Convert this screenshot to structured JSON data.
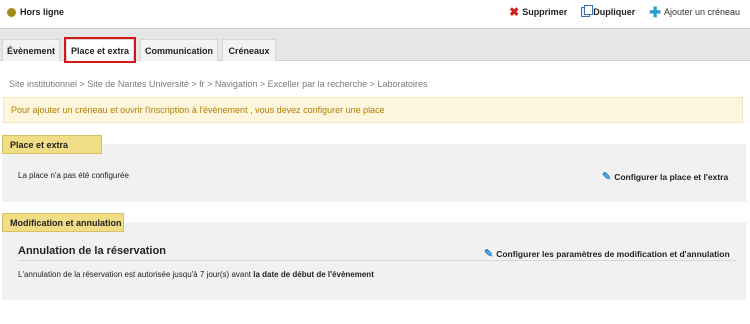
{
  "status": {
    "label": "Hors ligne"
  },
  "actions": {
    "delete": "Supprimer",
    "duplicate": "Dupliquer",
    "add_slot": "Ajouter un créneau"
  },
  "tabs": [
    {
      "label": "Évènement"
    },
    {
      "label": "Place et extra"
    },
    {
      "label": "Communication"
    },
    {
      "label": "Créneaux"
    }
  ],
  "breadcrumb": "Site institutionnel > Site de Nantes Université > fr > Navigation > Exceller par la recherche > Laboratoires",
  "warning": "Pour ajouter un créneau et ouvrir l'inscription à l'évènement , vous devez configurer une place",
  "place_section": {
    "title": "Place et extra",
    "text": "La place n'a pas été configurée",
    "link": "Configurer la place et l'extra"
  },
  "modif_section": {
    "title": "Modification et annulation",
    "subtitle": "Annulation de la réservation",
    "link": "Configurer les paramètres de modification et d'annulation",
    "text_prefix": "L'annulation de la réservation est autorisée jusqu'à",
    "days": "7",
    "text_middle": "jour(s) avant",
    "text_bold": "la date de début de l'évènement"
  },
  "colors": {
    "active_tab_outline": "#d11717",
    "section_header": "#f1dd86",
    "warning_text": "#b27c00",
    "status_dot": "#a38b1a"
  },
  "icons": {
    "status": "status-dot-icon",
    "delete": "delete-x-icon",
    "duplicate": "duplicate-icon",
    "add": "plus-icon",
    "edit": "pencil-icon"
  }
}
